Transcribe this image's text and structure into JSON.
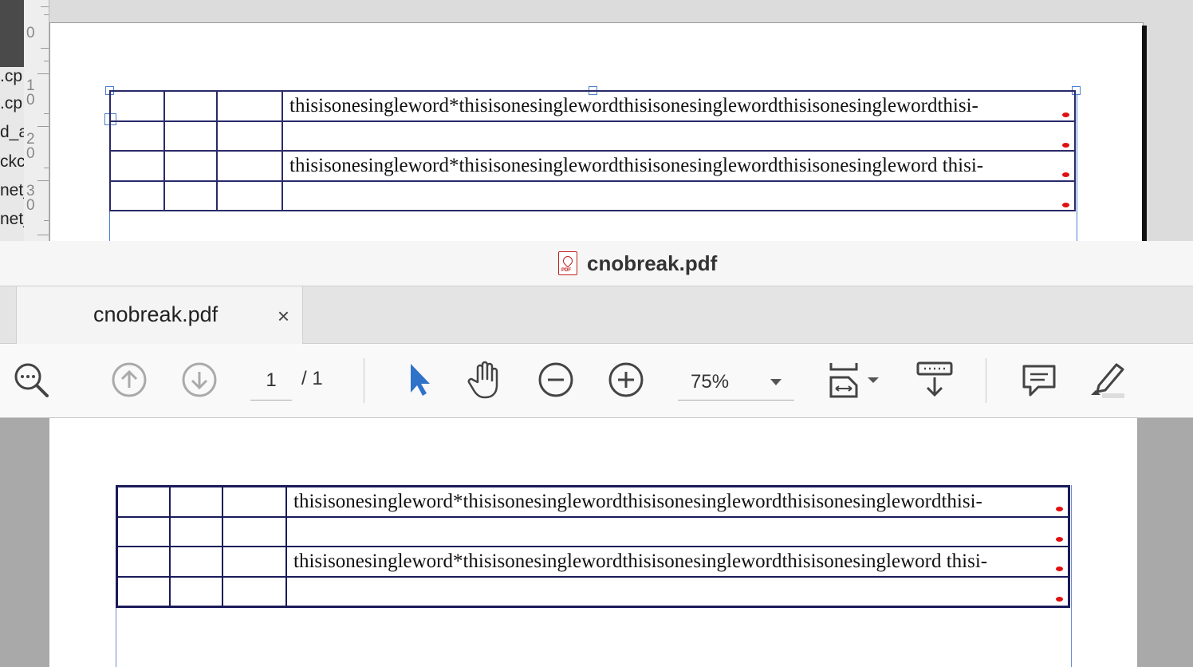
{
  "editor": {
    "file_list": [
      ".cp",
      ".cp",
      "d_a",
      "ckc",
      "net_",
      "net_"
    ],
    "ruler_numbers": [
      "0",
      "1",
      "0",
      "2",
      "0",
      "3",
      "0"
    ],
    "table": {
      "rows": [
        {
          "text": "thisisonesingleword*thisisonesinglewordthisisonesinglewordthisisonesinglewordthisi-"
        },
        {
          "text": ""
        },
        {
          "text": "thisisonesingleword*thisisonesinglewordthisisonesinglewordthisisonesingleword thisi-"
        },
        {
          "text": ""
        }
      ]
    }
  },
  "viewer": {
    "window_title": "cnobreak.pdf",
    "tab": {
      "label": "cnobreak.pdf",
      "close": "×"
    },
    "toolbar": {
      "page_current": "1",
      "page_total": "/ 1",
      "zoom": "75%"
    },
    "icons": [
      "zoom-search-icon",
      "previous-page-icon",
      "next-page-icon",
      "select-arrow-icon",
      "hand-icon",
      "zoom-out-icon",
      "zoom-in-icon",
      "fit-page-icon",
      "scroll-mode-icon",
      "comment-icon",
      "highlight-icon"
    ],
    "table": {
      "rows": [
        {
          "text": "thisisonesingleword*thisisonesinglewordthisisonesinglewordthisisonesinglewordthisi-"
        },
        {
          "text": ""
        },
        {
          "text": "thisisonesingleword*thisisonesinglewordthisisonesinglewordthisisonesingleword thisi-"
        },
        {
          "text": ""
        }
      ]
    }
  },
  "colors": {
    "accent": "#2f72c9",
    "marker": "#e01010",
    "table_border": "#1a1a5a"
  }
}
